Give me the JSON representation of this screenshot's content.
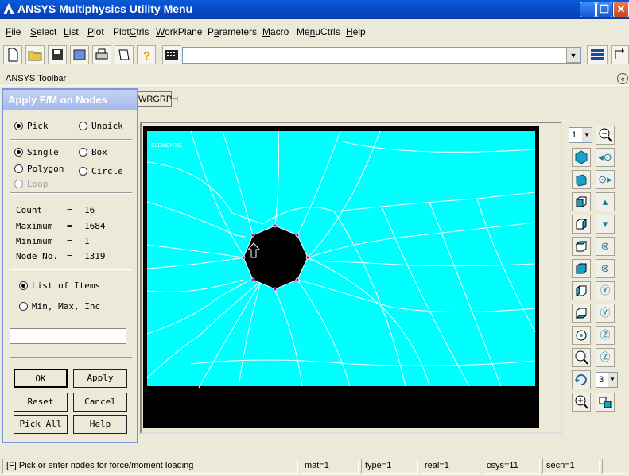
{
  "window": {
    "title": "ANSYS Multiphysics Utility Menu",
    "controls": {
      "minimize": "_",
      "maximize": "❐",
      "close": "✕"
    }
  },
  "menu": [
    {
      "pre": "",
      "u": "F",
      "post": "ile"
    },
    {
      "pre": "",
      "u": "S",
      "post": "elect"
    },
    {
      "pre": "",
      "u": "L",
      "post": "ist"
    },
    {
      "pre": "",
      "u": "P",
      "post": "lot"
    },
    {
      "pre": "Plot",
      "u": "C",
      "post": "trls"
    },
    {
      "pre": "",
      "u": "W",
      "post": "orkPlane"
    },
    {
      "pre": "P",
      "u": "a",
      "post": "rameters"
    },
    {
      "pre": "",
      "u": "M",
      "post": "acro"
    },
    {
      "pre": "Me",
      "u": "n",
      "post": "uCtrls"
    },
    {
      "pre": "",
      "u": "H",
      "post": "elp"
    }
  ],
  "toolbar": {
    "icons": [
      "new-file-icon",
      "open-folder-icon",
      "save-icon",
      "save-db-icon",
      "print-icon",
      "report-icon",
      "help-icon",
      "keyboard-icon"
    ],
    "command_value": ""
  },
  "ansys_toolbar": {
    "label": "ANSYS Toolbar",
    "buttons": [
      "WRGRPH"
    ],
    "collapse_glyph": "«"
  },
  "graphics": {
    "label_elements": "ELEMENTS",
    "label_small": "",
    "colors": {
      "mesh": "#00ffff",
      "background": "#000000",
      "lines": "#ffffff",
      "node": "#c000c0"
    }
  },
  "right_panel": {
    "window_number": "1",
    "view_select": "3"
  },
  "dialog": {
    "title": "Apply F/M on Nodes",
    "pick_mode": [
      {
        "label": "Pick",
        "checked": true
      },
      {
        "label": "Unpick",
        "checked": false
      }
    ],
    "shape": [
      {
        "label": "Single",
        "checked": true
      },
      {
        "label": "Box",
        "checked": false
      },
      {
        "label": "Polygon",
        "checked": false
      },
      {
        "label": "Circle",
        "checked": false
      },
      {
        "label": "Loop",
        "checked": false,
        "disabled": true
      }
    ],
    "stats": [
      {
        "label": "Count",
        "eq": "=",
        "value": "16"
      },
      {
        "label": "Maximum",
        "eq": "=",
        "value": "1684"
      },
      {
        "label": "Minimum",
        "eq": "=",
        "value": "1"
      },
      {
        "label": "Node No.",
        "eq": "=",
        "value": "1319"
      }
    ],
    "list_mode": [
      {
        "label": "List of Items",
        "checked": true
      },
      {
        "label": "Min, Max, Inc",
        "checked": false
      }
    ],
    "list_value": "",
    "buttons": {
      "ok": "OK",
      "apply": "Apply",
      "reset": "Reset",
      "cancel": "Cancel",
      "pick_all": "Pick All",
      "help": "Help"
    }
  },
  "status_bar": {
    "prompt": "[F]  Pick or enter nodes for force/moment loading",
    "mat": "mat=1",
    "type": "type=1",
    "real": "real=1",
    "csys": "csys=11",
    "secn": "secn=1"
  }
}
